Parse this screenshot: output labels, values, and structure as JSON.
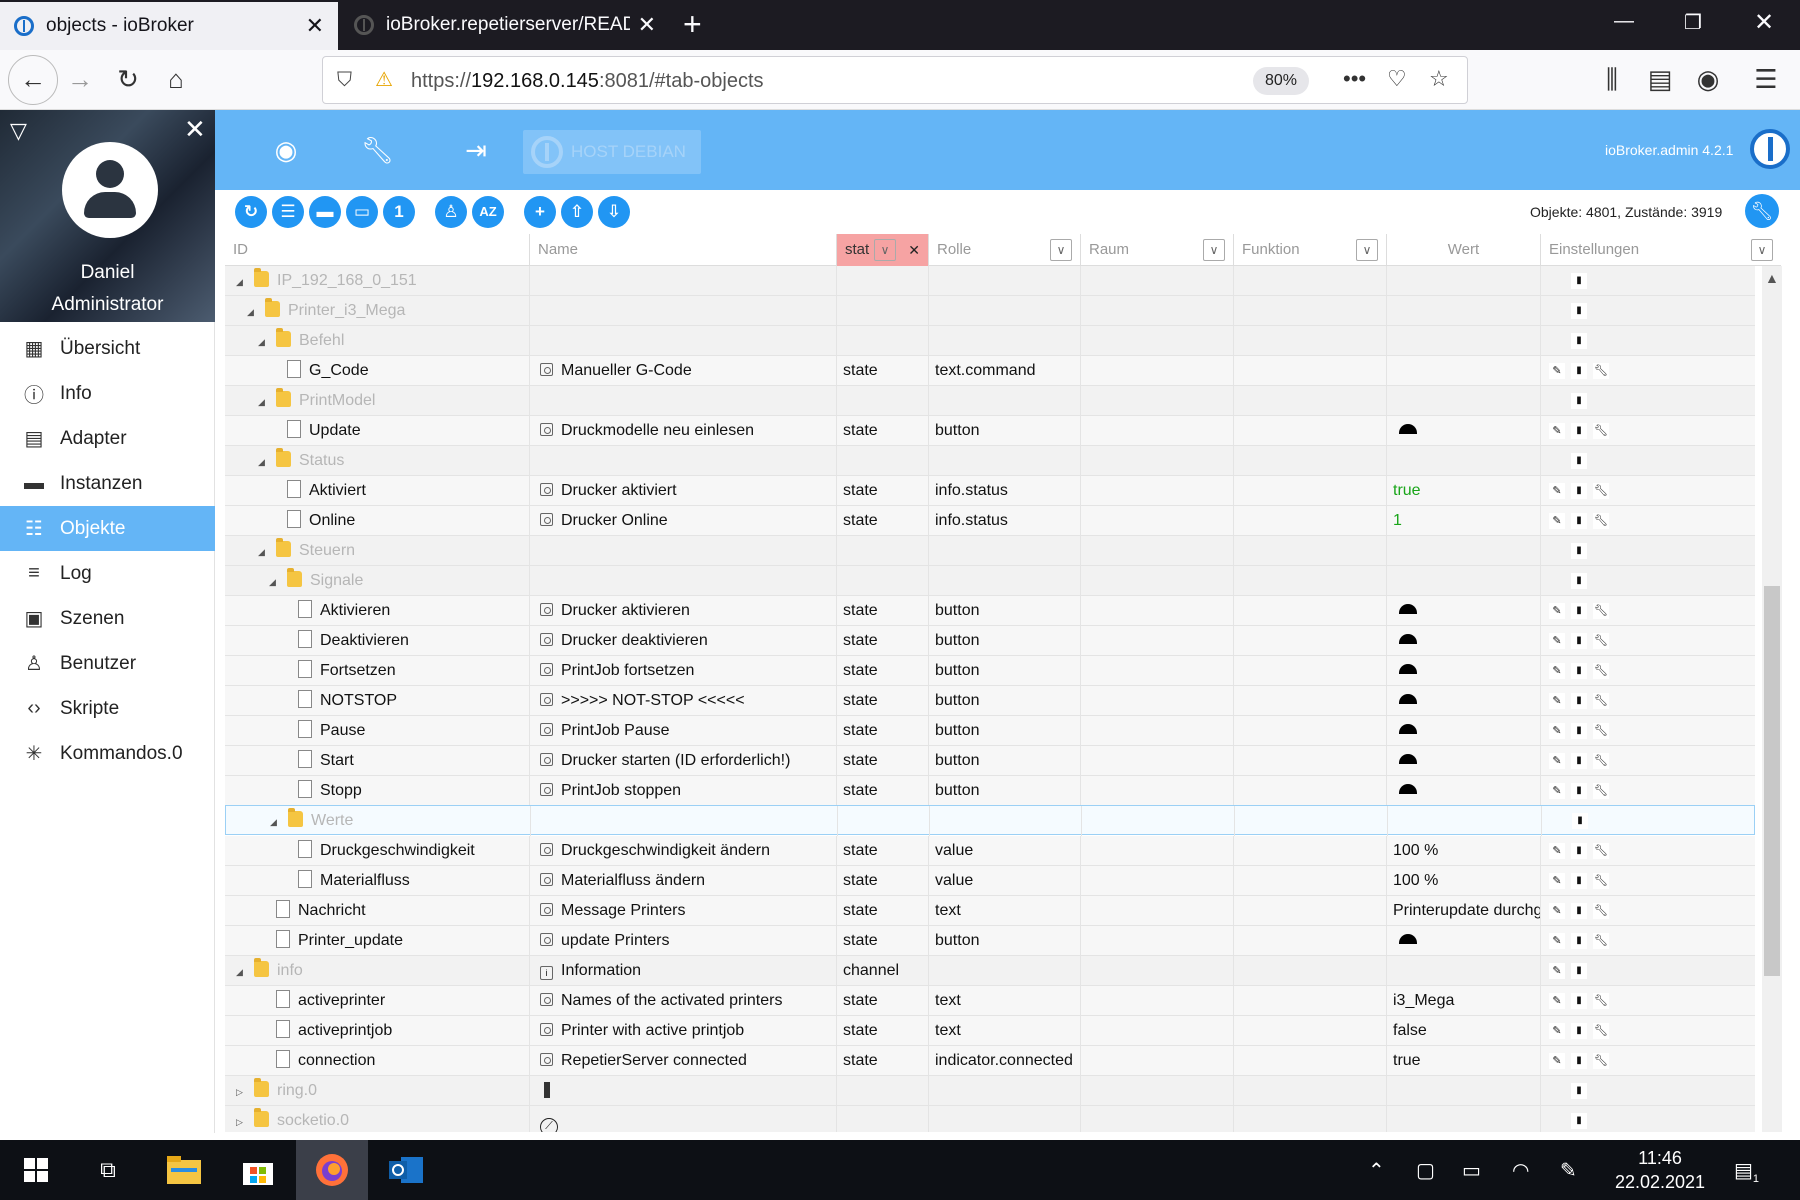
{
  "browser": {
    "tabs": [
      {
        "title": "objects - ioBroker",
        "active": true
      },
      {
        "title": "ioBroker.repetierserver/READM",
        "active": false
      }
    ],
    "url_prefix": "https://",
    "url_host": "192.168.0.145",
    "url_rest": ":8081/#tab-objects",
    "zoom": "80%"
  },
  "sidebar": {
    "user_name": "Daniel",
    "user_role": "Administrator",
    "items": [
      {
        "label": "Übersicht",
        "icon": "grid-icon",
        "active": false
      },
      {
        "label": "Info",
        "icon": "info-icon",
        "active": false
      },
      {
        "label": "Adapter",
        "icon": "store-icon",
        "active": false
      },
      {
        "label": "Instanzen",
        "icon": "instances-icon",
        "active": false
      },
      {
        "label": "Objekte",
        "icon": "list-icon",
        "active": true
      },
      {
        "label": "Log",
        "icon": "log-icon",
        "active": false
      },
      {
        "label": "Szenen",
        "icon": "scenes-icon",
        "active": false
      },
      {
        "label": "Benutzer",
        "icon": "user-icon",
        "active": false
      },
      {
        "label": "Skripte",
        "icon": "code-icon",
        "active": false
      },
      {
        "label": "Kommandos.0",
        "icon": "snowflake-icon",
        "active": false
      }
    ]
  },
  "header": {
    "host": "HOST DEBIAN",
    "version": "ioBroker.admin 4.2.1"
  },
  "toolbar": {
    "counts": "Objekte: 4801, Zustände: 3919"
  },
  "table": {
    "columns": {
      "id": "ID",
      "name": "Name",
      "type": "stat",
      "role": "Rolle",
      "room": "Raum",
      "function": "Funktion",
      "value": "Wert",
      "settings": "Einstellungen"
    },
    "rows": [
      {
        "kind": "folder",
        "level": 1,
        "id": "IP_192_168_0_151",
        "arrow": "open"
      },
      {
        "kind": "folder",
        "level": 2,
        "id": "Printer_i3_Mega",
        "arrow": "open"
      },
      {
        "kind": "folder",
        "level": 3,
        "id": "Befehl",
        "arrow": "open"
      },
      {
        "kind": "state",
        "level": 4,
        "id": "G_Code",
        "name": "Manueller G-Code",
        "type": "state",
        "role": "text.command",
        "value": ""
      },
      {
        "kind": "folder",
        "level": 3,
        "id": "PrintModel",
        "arrow": "open"
      },
      {
        "kind": "state",
        "level": 4,
        "id": "Update",
        "name": "Druckmodelle neu einlesen",
        "type": "state",
        "role": "button",
        "button": true
      },
      {
        "kind": "folder",
        "level": 3,
        "id": "Status",
        "arrow": "open"
      },
      {
        "kind": "state",
        "level": 4,
        "id": "Aktiviert",
        "name": "Drucker aktiviert",
        "type": "state",
        "role": "info.status",
        "value": "true",
        "green": true
      },
      {
        "kind": "state",
        "level": 4,
        "id": "Online",
        "name": "Drucker Online",
        "type": "state",
        "role": "info.status",
        "value": "1",
        "green": true
      },
      {
        "kind": "folder",
        "level": 3,
        "id": "Steuern",
        "arrow": "open"
      },
      {
        "kind": "folder",
        "level": 4,
        "id": "Signale",
        "arrow": "open"
      },
      {
        "kind": "state",
        "level": 5,
        "id": "Aktivieren",
        "name": "Drucker aktivieren",
        "type": "state",
        "role": "button",
        "button": true
      },
      {
        "kind": "state",
        "level": 5,
        "id": "Deaktivieren",
        "name": "Drucker deaktivieren",
        "type": "state",
        "role": "button",
        "button": true
      },
      {
        "kind": "state",
        "level": 5,
        "id": "Fortsetzen",
        "name": "PrintJob fortsetzen",
        "type": "state",
        "role": "button",
        "button": true
      },
      {
        "kind": "state",
        "level": 5,
        "id": "NOTSTOP",
        "name": ">>>>> NOT-STOP <<<<<",
        "type": "state",
        "role": "button",
        "button": true
      },
      {
        "kind": "state",
        "level": 5,
        "id": "Pause",
        "name": "PrintJob Pause",
        "type": "state",
        "role": "button",
        "button": true
      },
      {
        "kind": "state",
        "level": 5,
        "id": "Start",
        "name": "Drucker starten (ID erforderlich!)",
        "type": "state",
        "role": "button",
        "button": true
      },
      {
        "kind": "state",
        "level": 5,
        "id": "Stopp",
        "name": "PrintJob stoppen",
        "type": "state",
        "role": "button",
        "button": true
      },
      {
        "kind": "folder",
        "level": 4,
        "id": "Werte",
        "arrow": "open",
        "selected": true
      },
      {
        "kind": "state",
        "level": 5,
        "id": "Druckgeschwindigkeit",
        "name": "Druckgeschwindigkeit ändern",
        "type": "state",
        "role": "value",
        "value": "100 %"
      },
      {
        "kind": "state",
        "level": 5,
        "id": "Materialfluss",
        "name": "Materialfluss ändern",
        "type": "state",
        "role": "value",
        "value": "100 %"
      },
      {
        "kind": "state",
        "level": 3,
        "id": "Nachricht",
        "name": "Message Printers",
        "type": "state",
        "role": "text",
        "value": "Printerupdate durchg"
      },
      {
        "kind": "state",
        "level": 3,
        "id": "Printer_update",
        "name": "update Printers",
        "type": "state",
        "role": "button",
        "button": true
      },
      {
        "kind": "folder",
        "level": 1,
        "id": "info",
        "arrow": "open",
        "name": "Information",
        "channel": true,
        "type": "channel"
      },
      {
        "kind": "state",
        "level": 3,
        "id": "activeprinter",
        "name": "Names of the activated printers",
        "type": "state",
        "role": "text",
        "value": "i3_Mega"
      },
      {
        "kind": "state",
        "level": 3,
        "id": "activeprintjob",
        "name": "Printer with active printjob",
        "type": "state",
        "role": "text",
        "value": "false"
      },
      {
        "kind": "state",
        "level": 3,
        "id": "connection",
        "name": "RepetierServer connected",
        "type": "state",
        "role": "indicator.connected",
        "value": "true"
      },
      {
        "kind": "folder",
        "level": 1,
        "id": "ring.0",
        "arrow": "closed",
        "icon": "device"
      },
      {
        "kind": "folder",
        "level": 1,
        "id": "socketio.0",
        "arrow": "closed",
        "icon": "clock"
      }
    ]
  },
  "taskbar": {
    "time": "11:46",
    "date": "22.02.2021",
    "notification_count": "1"
  },
  "colors": {
    "header_blue": "#64b5f6",
    "button_blue": "#2196f3",
    "filter_red": "#f6a3a3",
    "value_green": "#19a519"
  }
}
